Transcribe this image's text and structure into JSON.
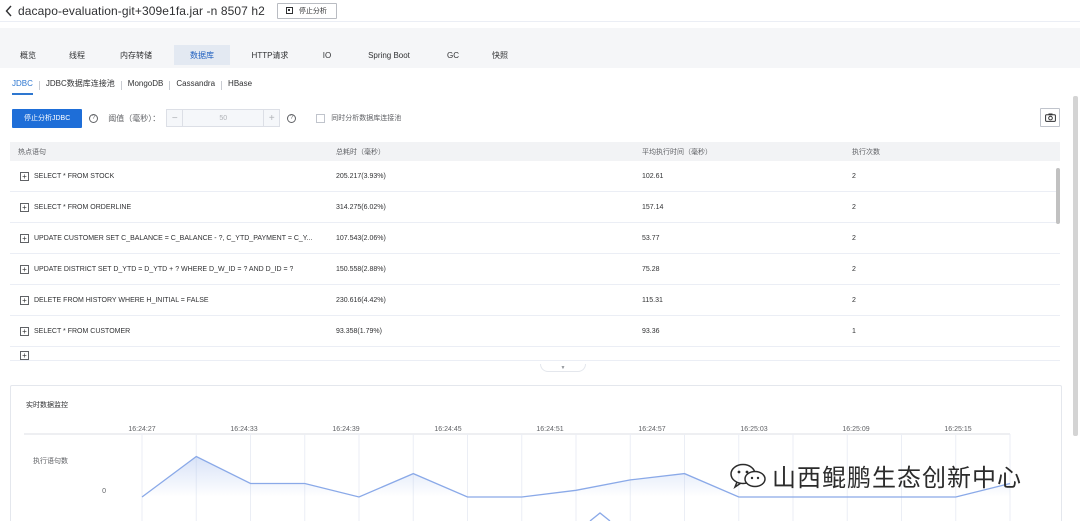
{
  "header": {
    "title": "dacapo-evaluation-git+309e1fa.jar -n 8507 h2",
    "stop_button": "停止分析"
  },
  "top_tabs": [
    {
      "label": "概览",
      "active": false
    },
    {
      "label": "线程",
      "active": false
    },
    {
      "label": "内存转储",
      "active": false
    },
    {
      "label": "数据库",
      "active": true
    },
    {
      "label": "HTTP请求",
      "active": false
    },
    {
      "label": "IO",
      "active": false
    },
    {
      "label": "Spring Boot",
      "active": false
    },
    {
      "label": "GC",
      "active": false
    },
    {
      "label": "快照",
      "active": false
    }
  ],
  "sub_tabs": [
    {
      "label": "JDBC",
      "active": true
    },
    {
      "label": "JDBC数据库连接池",
      "active": false
    },
    {
      "label": "MongoDB",
      "active": false
    },
    {
      "label": "Cassandra",
      "active": false
    },
    {
      "label": "HBase",
      "active": false
    }
  ],
  "toolbar": {
    "stop_jdbc_button": "停止分析JDBC",
    "threshold_label": "阈值（毫秒）：",
    "threshold_value": "50",
    "analyze_pool_label": "同时分析数据库连接池"
  },
  "table": {
    "columns": [
      "热点语句",
      "总耗时（毫秒）",
      "平均执行时间（毫秒）",
      "执行次数"
    ],
    "rows": [
      {
        "sql": "SELECT * FROM STOCK",
        "total": "205.217(3.93%)",
        "avg": "102.61",
        "count": "2"
      },
      {
        "sql": "SELECT * FROM ORDERLINE",
        "total": "314.275(6.02%)",
        "avg": "157.14",
        "count": "2"
      },
      {
        "sql": "UPDATE CUSTOMER SET C_BALANCE = C_BALANCE - ?, C_YTD_PAYMENT = C_Y...",
        "total": "107.543(2.06%)",
        "avg": "53.77",
        "count": "2"
      },
      {
        "sql": "UPDATE DISTRICT SET D_YTD = D_YTD + ? WHERE D_W_ID = ? AND D_ID = ?",
        "total": "150.558(2.88%)",
        "avg": "75.28",
        "count": "2"
      },
      {
        "sql": "DELETE FROM HISTORY WHERE H_INITIAL = FALSE",
        "total": "230.616(4.42%)",
        "avg": "115.31",
        "count": "2"
      },
      {
        "sql": "SELECT * FROM CUSTOMER",
        "total": "93.358(1.79%)",
        "avg": "93.36",
        "count": "1"
      }
    ]
  },
  "monitor": {
    "title": "实时数据监控",
    "chart_data": {
      "type": "line",
      "x": [
        "16:24:27",
        "16:24:33",
        "16:24:39",
        "16:24:45",
        "16:24:51",
        "16:24:57",
        "16:25:03",
        "16:25:09",
        "16:25:15"
      ],
      "series": [
        {
          "name": "执行语句数",
          "y_min_label": "0",
          "points": [
            0,
            0.9,
            0.3,
            0.3,
            0,
            0.52,
            0,
            0,
            0.15,
            0.38,
            0.52,
            0,
            0,
            0,
            0,
            0,
            0.3
          ]
        }
      ],
      "grid": true
    }
  },
  "watermark": {
    "text": "山西鲲鹏生态创新中心"
  },
  "colors": {
    "primary": "#1e6ed8",
    "line": "#8aa9e8",
    "active_tab_bg": "#e3e9f2"
  }
}
